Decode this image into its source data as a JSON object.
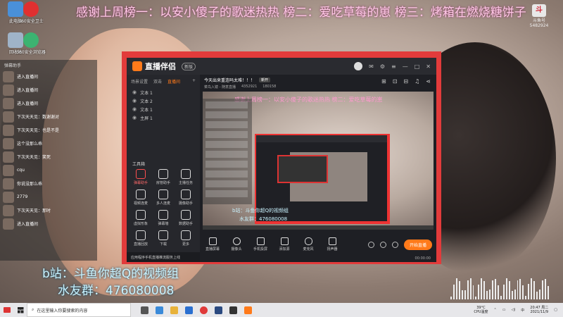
{
  "banner_text": "感谢上周榜一：以安小傻子的歌迷热热 榜二：爱吃草莓的崽 榜三：烤箱在燃烧糖饼子",
  "corner_logo": {
    "icon": "douyu-logo",
    "label": "斗鱼号",
    "number": "5482924"
  },
  "desktop_icons": [
    "此电脑",
    "360安全卫士",
    "回收站",
    "360安全浏览器"
  ],
  "chat": {
    "header": "弹幕助手",
    "messages": [
      {
        "name": "",
        "text": "进入直播间"
      },
      {
        "name": "",
        "text": "进入直播间"
      },
      {
        "name": "",
        "text": "进入直播间"
      },
      {
        "name": "",
        "text": "下次天天见：数谢谢对"
      },
      {
        "name": "",
        "text": "下次天天见：也是不是"
      },
      {
        "name": "",
        "text": "这个没那么乖"
      },
      {
        "name": "",
        "text": "下次天天见：笑死"
      },
      {
        "name": "",
        "text": "cqu"
      },
      {
        "name": "",
        "text": "你说没那么乖"
      },
      {
        "name": "",
        "text": "2779"
      },
      {
        "name": "",
        "text": "下次天天见：那时"
      },
      {
        "name": "",
        "text": "进入直播间"
      }
    ]
  },
  "overlay": {
    "bili": "b站：斗鱼你超Q的视频组",
    "qq": "水友群：476080008"
  },
  "app": {
    "name": "直播伴侣",
    "version": "新版",
    "scene_tabs": [
      "场景设置",
      "双击",
      "直播间"
    ],
    "scenes": [
      "文本 1",
      "文本 2",
      "文本 1",
      "主屏 1"
    ],
    "tools_title": "工具箱",
    "tools": [
      {
        "label": "弹幕助手",
        "icon": "danmu-icon",
        "red": true
      },
      {
        "label": "房管助手",
        "icon": "admin-icon",
        "red": false
      },
      {
        "label": "主播任务",
        "icon": "task-icon",
        "red": false
      },
      {
        "label": "视频连麦",
        "icon": "video-link-icon",
        "red": false
      },
      {
        "label": "多人连麦",
        "icon": "multi-link-icon",
        "red": false
      },
      {
        "label": "摄像助手",
        "icon": "camera-assist-icon",
        "red": false
      },
      {
        "label": "虚拟形象",
        "icon": "avatar-icon",
        "red": false
      },
      {
        "label": "弹幕墙",
        "icon": "wall-icon",
        "red": false
      },
      {
        "label": "数据助手",
        "icon": "data-icon",
        "red": false
      },
      {
        "label": "直播回放",
        "icon": "replay-icon",
        "red": false
      },
      {
        "label": "下载",
        "icon": "download-icon",
        "red": false
      },
      {
        "label": "更多",
        "icon": "more-icon",
        "red": false
      }
    ],
    "promo": "应用程序手机直播推流服务上线",
    "room_title": "今天出来重连吗太难！！！",
    "room_tag": "新开",
    "room_meta": [
      "菜鸟入镜 - 随意直播",
      "4352921",
      "180158"
    ],
    "preview_text": "感谢上周榜一：以安小傻子的歌迷热热 榜二：爱吃草莓的崽",
    "controls": [
      {
        "label": "直播屏幕",
        "icon": "screen-icon"
      },
      {
        "label": "摄像头",
        "icon": "camera-icon"
      },
      {
        "label": "手机投屏",
        "icon": "phone-icon"
      },
      {
        "label": "添加源",
        "icon": "add-source-icon"
      },
      {
        "label": "麦克风",
        "icon": "mic-icon"
      },
      {
        "label": "扬声器",
        "icon": "speaker-icon"
      }
    ],
    "start_button": "开始直播",
    "timer": "00:00:00"
  },
  "taskbar": {
    "search_placeholder": "在这里输入你要搜索的内容",
    "temp": "39°C",
    "cpu": "CPU温度",
    "time": "20:47 周二",
    "date": "2021/11/9"
  },
  "colors": {
    "accent": "#ff7a1a",
    "frame": "#e23b3b",
    "banner": "#ffc7e6",
    "overlay_text": "#c9f3ff"
  }
}
